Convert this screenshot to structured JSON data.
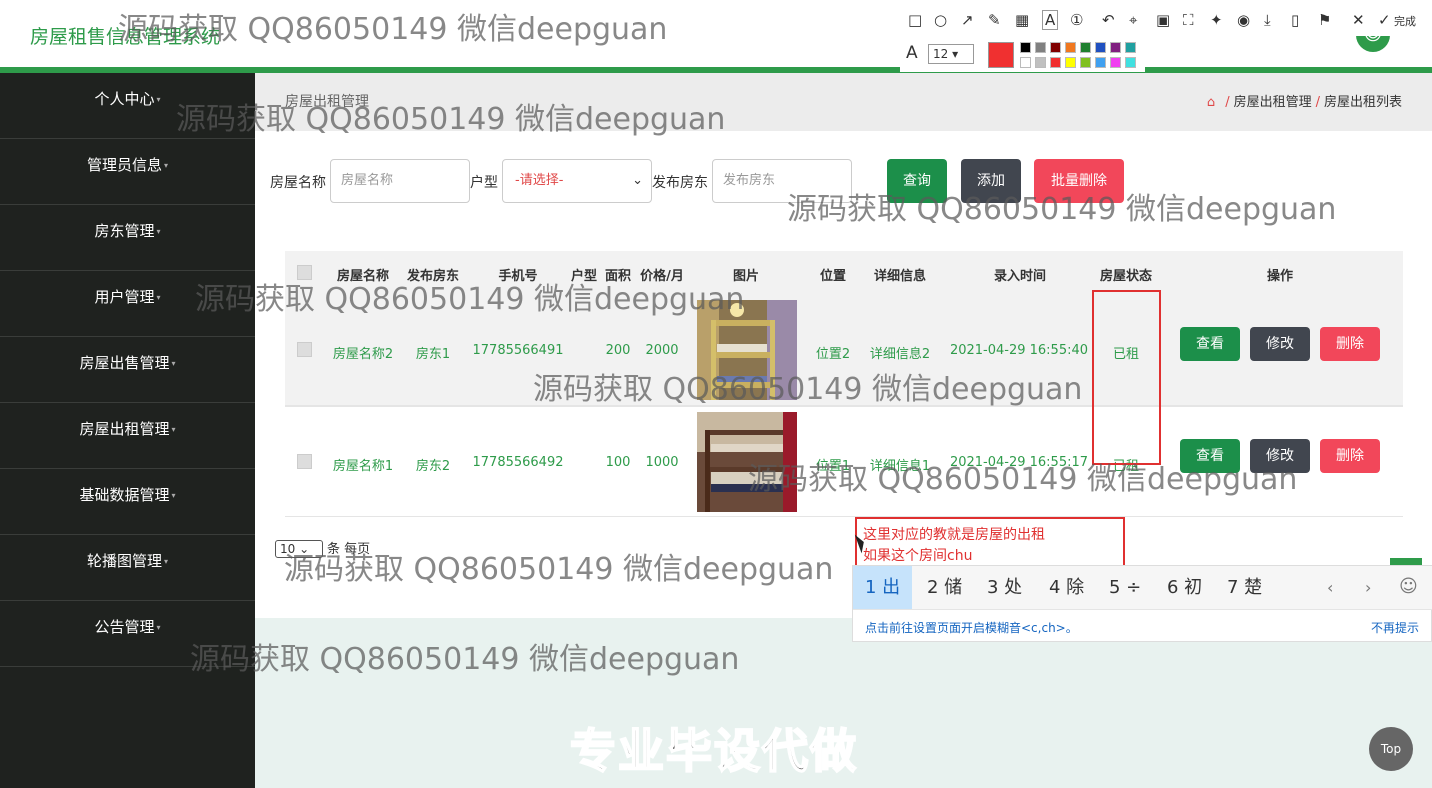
{
  "header": {
    "title": "房屋租售信息管理系统"
  },
  "sidebar": {
    "items": [
      {
        "label": "个人中心"
      },
      {
        "label": "管理员信息"
      },
      {
        "label": "房东管理"
      },
      {
        "label": "用户管理"
      },
      {
        "label": "房屋出售管理"
      },
      {
        "label": "房屋出租管理"
      },
      {
        "label": "基础数据管理"
      },
      {
        "label": "轮播图管理"
      },
      {
        "label": "公告管理"
      }
    ]
  },
  "breadcrumb": {
    "left": "房屋出租管理",
    "home_icon": "home-icon",
    "items": [
      "房屋出租管理",
      "房屋出租列表"
    ],
    "sep": "/"
  },
  "filter": {
    "name_label": "房屋名称",
    "name_placeholder": "房屋名称",
    "type_label": "户型",
    "type_value": "-请选择-",
    "landlord_label": "发布房东",
    "landlord_placeholder": "发布房东",
    "query": "查询",
    "add": "添加",
    "batch_delete": "批量删除"
  },
  "table": {
    "headers": [
      "房屋名称",
      "发布房东",
      "手机号",
      "户型",
      "面积",
      "价格/月",
      "图片",
      "位置",
      "详细信息",
      "录入时间",
      "房屋状态",
      "操作"
    ],
    "rows": [
      {
        "name": "房屋名称2",
        "landlord": "房东1",
        "phone": "17785566491",
        "type": "",
        "area": "200",
        "price": "2000",
        "location": "位置2",
        "detail": "详细信息2",
        "time": "2021-04-29 16:55:40",
        "status": "已租"
      },
      {
        "name": "房屋名称1",
        "landlord": "房东2",
        "phone": "17785566492",
        "type": "",
        "area": "100",
        "price": "1000",
        "location": "位置1",
        "detail": "详细信息1",
        "time": "2021-04-29 16:55:17",
        "status": "已租"
      }
    ],
    "view": "查看",
    "edit": "修改",
    "delete": "删除"
  },
  "pager": {
    "page_size": "10",
    "per_page_label": "条 每页"
  },
  "note": {
    "line1": "这里对应的教就是房屋的出租",
    "line2": "如果这个房间chu"
  },
  "ime": {
    "candidates": [
      "1 出",
      "2 储",
      "3 处",
      "4 除",
      "5 ÷",
      "6 初",
      "7 楚"
    ],
    "hint": "点击前往设置页面开启模糊音<c,ch>。",
    "dismiss": "不再提示"
  },
  "toolbar": {
    "done": "完成",
    "font_size": "12",
    "current_color": "#f03030",
    "swatches": [
      "#000000",
      "#808080",
      "#800000",
      "#f07820",
      "#208030",
      "#2050c0",
      "#802080",
      "#20a0a0",
      "#ffffff",
      "#c0c0c0",
      "#f03030",
      "#ffff00",
      "#80c020",
      "#40a0f0",
      "#f040f0",
      "#40e0e0"
    ]
  },
  "watermark": "源码获取 QQ86050149 微信deepguan",
  "promo": "专业毕设代做",
  "top_button": "Top"
}
